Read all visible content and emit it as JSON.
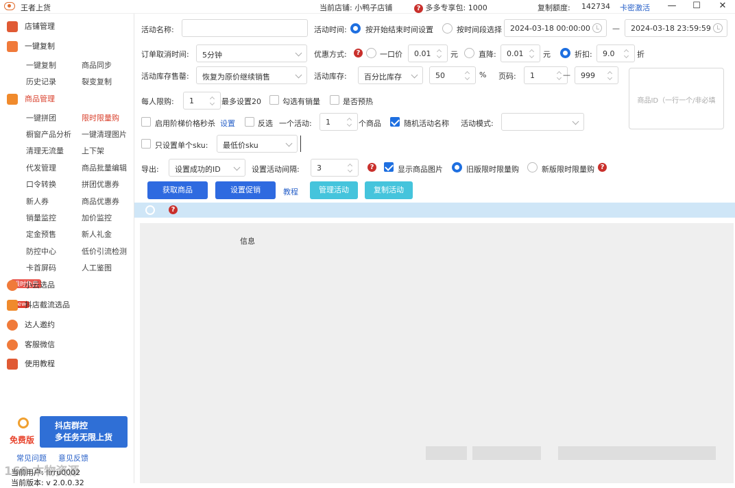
{
  "window": {
    "title": "王者上货",
    "shop_label": "当前店铺: 小鸭子店铺",
    "package_label": "多多专享包: 1000",
    "copy_quota_label": "复制额度:",
    "copy_quota_value": "142734",
    "activate_label": "卡密激活"
  },
  "sidebar": {
    "store_manage": "店铺管理",
    "one_click_copy": "一键复制",
    "copy_items": [
      "一键复制",
      "商品同步",
      "历史记录",
      "裂变复制"
    ],
    "product_manage": "商品管理",
    "product_items": [
      "一键拼团",
      "限时限量购",
      "橱窗产品分析",
      "一键清理图片",
      "清理无流量",
      "上下架",
      "代发管理",
      "商品批量编辑",
      "口令转换",
      "拼团优惠券",
      "新人券",
      "商品优惠券",
      "销量监控",
      "加价监控",
      "定金预售",
      "新人礼金",
      "防控中心",
      "低价引流检测",
      "卡首屏码",
      "人工鉴图"
    ],
    "xiaoyun": "小云选品",
    "xiaoyun_badge": "限时免费",
    "douyin": "抖店截流选品",
    "douyin_badge": "new",
    "influencer": "达人邀约",
    "wechat": "客服微信",
    "tutorial": "使用教程",
    "promo_free": "免费版",
    "promo_line1": "抖店群控",
    "promo_line2": "多任务无限上货",
    "faq": "常见问题",
    "feedback": "意见反馈",
    "current_user": "当前用户: lirru0002",
    "current_version": "当前版本: v 2.0.0.32",
    "watermark": "169 本物资源"
  },
  "form": {
    "activity_name_label": "活动名称:",
    "activity_name_value": "",
    "activity_time_label": "活动时间:",
    "time_option_1": "按开始结束时间设置",
    "time_option_2": "按时间段选择",
    "start_time": "2024-03-18 00:00:00",
    "dash": "—",
    "end_time": "2024-03-18 23:59:59",
    "cancel_time_label": "订单取消时间:",
    "cancel_time_value": "5分钟",
    "discount_label": "优惠方式:",
    "discount_opt1": "一口价",
    "discount_val1": "0.01",
    "unit_yuan": "元",
    "discount_opt2": "直降:",
    "discount_val2": "0.01",
    "discount_opt3": "折扣:",
    "discount_val3": "9.0",
    "unit_zhe": "折",
    "stock_sold_label": "活动库存售罄:",
    "stock_sold_value": "恢复为原价继续销售",
    "stock_label": "活动库存:",
    "stock_mode": "百分比库存",
    "stock_value": "50",
    "percent": "%",
    "page_label": "页码:",
    "page_from": "1",
    "page_to": "999",
    "id_placeholder": "商品ID（一行一个/非必填",
    "per_limit_label": "每人限购:",
    "per_limit_value": "1",
    "per_limit_hint": "最多设置20",
    "check_sales": "勾选有销量",
    "check_presale": "是否预热",
    "tier_label": "启用阶梯价格秒杀",
    "tier_link": "设置",
    "reverse_label": "反选",
    "one_activity_label": "一个活动:",
    "one_activity_value": "1",
    "goods_unit": "个商品",
    "random_name": "随机活动名称",
    "mode_label": "活动模式:",
    "mode_value": "",
    "single_sku_label": "只设置单个sku:",
    "single_sku_value": "最低价sku",
    "export_label": "导出:",
    "export_value": "设置成功的ID",
    "interval_label": "设置活动间隔:",
    "interval_value": "3",
    "show_image": "显示商品图片",
    "old_version": "旧版限时限量购",
    "new_version": "新版限时限量购",
    "btn_get": "获取商品",
    "btn_set": "设置促销",
    "tutorial_link": "教程",
    "btn_manage": "管理活动",
    "btn_copy": "复制活动",
    "log_header": "信息"
  },
  "colors": {
    "accent": "#2e6ae0",
    "cyan": "#45c4dc",
    "danger": "#c9302c",
    "strip": "#cfe6f7"
  }
}
